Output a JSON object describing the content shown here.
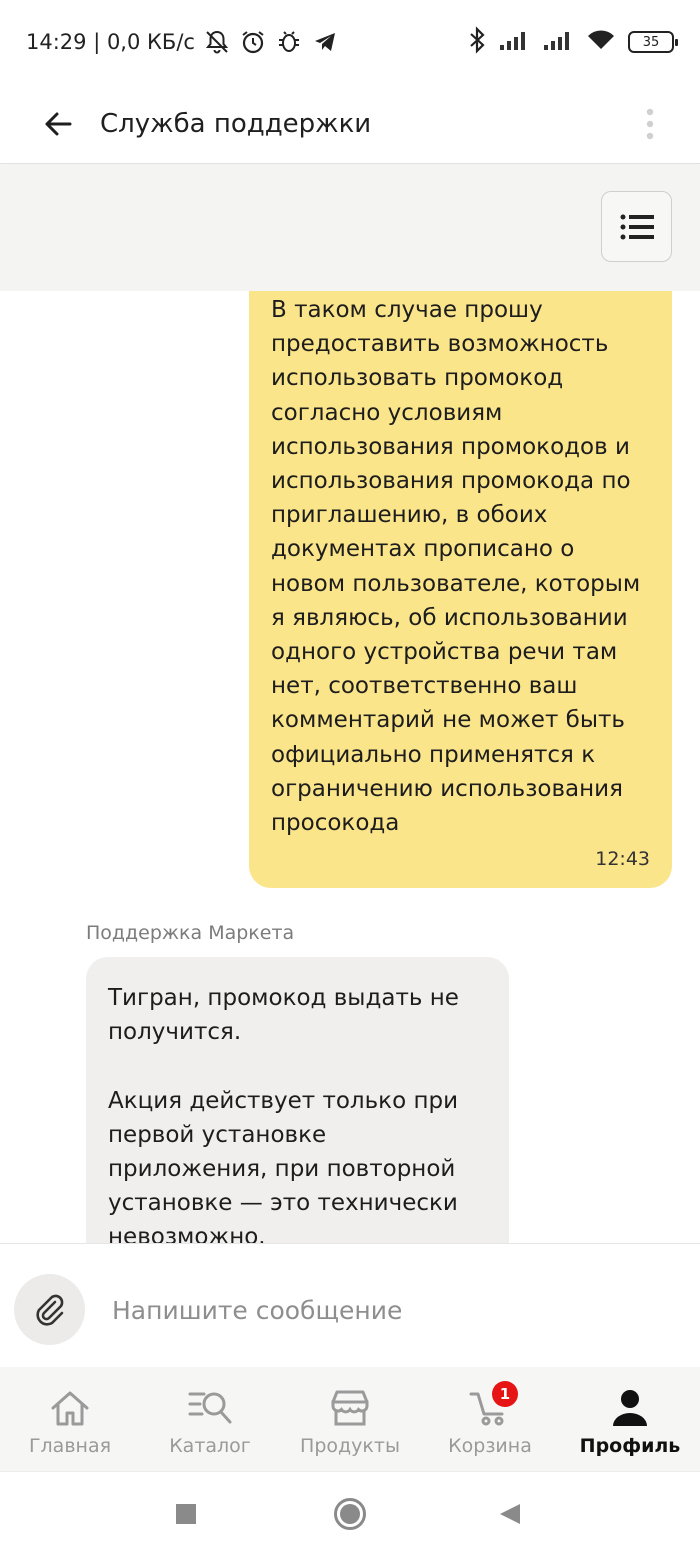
{
  "status_bar": {
    "time_and_speed": "14:29 | 0,0 КБ/с",
    "battery": "35"
  },
  "header": {
    "title": "Служба поддержки"
  },
  "chat": {
    "outgoing": {
      "text": "В таком случае прошу\nпредоставить возможность\nиспользовать промокод\nсогласно условиям\nиспользования промокодов и\nиспользования промокода по\nприглашению, в обоих\nдокументах прописано о\nновом пользователе, которым\nя являюсь, об использовании\nодного устройства речи там\nнет, соответственно ваш\nкомментарий не может быть\nофициально применятся к\nограничению использования\nпросокода",
      "time": "12:43"
    },
    "incoming": {
      "sender": "Поддержка Маркета",
      "text": "Тигран, промокод выдать не\nполучится.\n\nАкция действует только при\nпервой установке\nприложения, при повторной\nустановке — это технически\nневозможно."
    }
  },
  "composer": {
    "placeholder": "Напишите сообщение"
  },
  "bottom_nav": {
    "items": [
      {
        "label": "Главная",
        "icon": "home-icon"
      },
      {
        "label": "Каталог",
        "icon": "catalog-search-icon"
      },
      {
        "label": "Продукты",
        "icon": "store-icon"
      },
      {
        "label": "Корзина",
        "icon": "cart-icon"
      },
      {
        "label": "Профиль",
        "icon": "profile-icon",
        "active": true
      }
    ],
    "cart_badge": "1"
  },
  "colors": {
    "outgoing_bubble": "#fbe58a",
    "incoming_bubble": "#f0efed",
    "badge": "#e61414"
  }
}
